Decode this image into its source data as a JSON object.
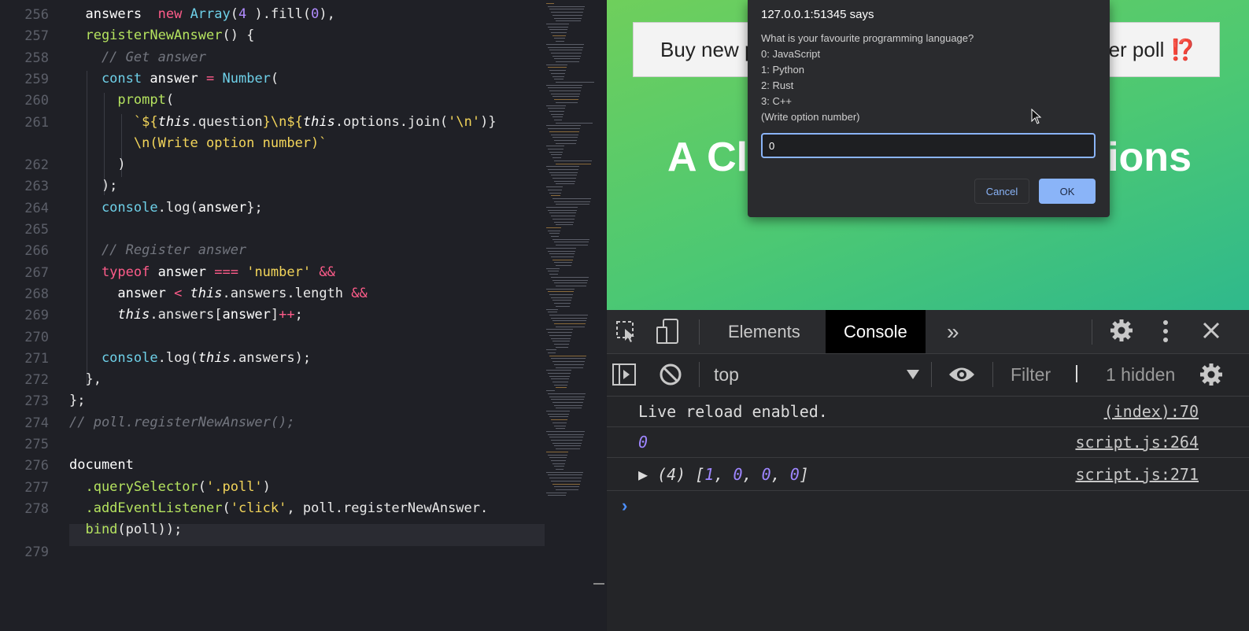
{
  "editor": {
    "line_numbers": [
      "256",
      "257",
      "258",
      "259",
      "260",
      "261",
      "",
      "262",
      "263",
      "264",
      "265",
      "266",
      "267",
      "268",
      "269",
      "270",
      "271",
      "272",
      "273",
      "274",
      "275",
      "276",
      "277",
      "278",
      "",
      "279"
    ],
    "lines": [
      {
        "segments": [
          [
            "pr",
            "  answers"
          ],
          [
            "",
            "  "
          ],
          [
            "kw",
            "new "
          ],
          [
            "cls",
            "Array"
          ],
          [
            "",
            "("
          ],
          [
            "nm",
            "4"
          ],
          [
            "",
            " ).fill("
          ],
          [
            "nm",
            "0"
          ],
          [
            "",
            "),"
          ]
        ]
      },
      {
        "segments": [
          [
            "fn",
            "  registerNewAnswer"
          ],
          [
            "",
            "() {"
          ]
        ]
      },
      {
        "segments": [
          [
            "cm",
            "    // Get answer"
          ]
        ]
      },
      {
        "segments": [
          [
            "cls",
            "    const "
          ],
          [
            "pr",
            "answer "
          ],
          [
            "kw",
            "= "
          ],
          [
            "cls",
            "Number"
          ],
          [
            "",
            "("
          ]
        ]
      },
      {
        "segments": [
          [
            "fn",
            "      prompt"
          ],
          [
            "",
            "("
          ]
        ]
      },
      {
        "segments": [
          [
            "st",
            "        `${"
          ],
          [
            "it",
            "this"
          ],
          [
            "",
            ".question"
          ],
          [
            "st",
            "}\\n${"
          ],
          [
            "it",
            "this"
          ],
          [
            "",
            ".options"
          ],
          [
            "",
            ".join("
          ],
          [
            "st",
            "'\\n'"
          ],
          [
            "",
            ")}"
          ]
        ]
      },
      {
        "segments": [
          [
            "st",
            "        \\n(Write option number)`"
          ]
        ]
      },
      {
        "segments": [
          [
            "",
            "      )"
          ]
        ]
      },
      {
        "segments": [
          [
            "",
            "    );"
          ]
        ]
      },
      {
        "segments": [
          [
            "cls",
            "    console"
          ],
          [
            "",
            ".log("
          ],
          [
            "pr",
            "answer"
          ],
          [
            "",
            "};"
          ]
        ]
      },
      {
        "segments": [
          [
            "",
            ""
          ]
        ]
      },
      {
        "segments": [
          [
            "cm",
            "    // Register answer"
          ]
        ]
      },
      {
        "segments": [
          [
            "kw",
            "    typeof "
          ],
          [
            "pr",
            "answer "
          ],
          [
            "kw",
            "=== "
          ],
          [
            "st",
            "'number' "
          ],
          [
            "kw",
            "&&"
          ]
        ]
      },
      {
        "segments": [
          [
            "pr",
            "      answer "
          ],
          [
            "kw",
            "< "
          ],
          [
            "it",
            "this"
          ],
          [
            "",
            ".answers.length "
          ],
          [
            "kw",
            "&&"
          ]
        ]
      },
      {
        "segments": [
          [
            "it",
            "      this"
          ],
          [
            "",
            ".answers["
          ],
          [
            "pr",
            "answer"
          ],
          [
            "",
            "]"
          ],
          [
            "kw",
            "++"
          ],
          [
            "",
            ";"
          ]
        ]
      },
      {
        "segments": [
          [
            "",
            ""
          ]
        ]
      },
      {
        "segments": [
          [
            "cls",
            "    console"
          ],
          [
            "",
            ".log("
          ],
          [
            "it",
            "this"
          ],
          [
            "",
            ".answers);"
          ]
        ]
      },
      {
        "segments": [
          [
            "",
            "  },"
          ]
        ]
      },
      {
        "segments": [
          [
            "",
            "};"
          ]
        ]
      },
      {
        "segments": [
          [
            "cm",
            "// poll.registerNewAnswer();"
          ]
        ]
      },
      {
        "segments": [
          [
            "",
            ""
          ]
        ]
      },
      {
        "segments": [
          [
            "pr",
            "document"
          ]
        ]
      },
      {
        "segments": [
          [
            "fn",
            "  .querySelector"
          ],
          [
            "",
            "("
          ],
          [
            "st",
            "'.poll'"
          ],
          [
            "",
            ")"
          ]
        ]
      },
      {
        "segments": [
          [
            "fn",
            "  .addEventListener"
          ],
          [
            "",
            "("
          ],
          [
            "st",
            "'click'"
          ],
          [
            "",
            ", poll.registerNewAnswer."
          ]
        ]
      },
      {
        "segments": [
          [
            "fn",
            "  bind"
          ],
          [
            "",
            "(poll));"
          ]
        ]
      },
      {
        "segments": [
          [
            "",
            ""
          ]
        ]
      }
    ]
  },
  "browser": {
    "poll_button": {
      "left_text": "Buy new p",
      "right_text": "ver poll",
      "emoji": "⁉️"
    },
    "heading": {
      "left_text": "A Cl",
      "right_text": "ions"
    }
  },
  "dialog": {
    "title": "127.0.0.1:51345 says",
    "lines": [
      "What is your favourite programming language?",
      "0: JavaScript",
      "1: Python",
      "2: Rust",
      "3: C++",
      "(Write option number)"
    ],
    "input_value": "0",
    "cancel_label": "Cancel",
    "ok_label": "OK"
  },
  "devtools": {
    "tabs": {
      "elements": "Elements",
      "console": "Console",
      "more": "»"
    },
    "toolbar": {
      "context": "top",
      "filter_placeholder": "Filter",
      "hidden_count": "1 hidden"
    },
    "messages": [
      {
        "text": "Live reload enabled.",
        "source": "(index):70"
      },
      {
        "text": "0",
        "source": "script.js:264"
      },
      {
        "prefix": "▶ (4) [",
        "values": [
          "1",
          "0",
          "0",
          "0"
        ],
        "suffix": "]",
        "source": "script.js:271"
      }
    ],
    "prompt_symbol": "›"
  },
  "colors": {
    "accent": "#8ab4f8",
    "console_number": "#9e86ff",
    "keyword": "#ff5c8a",
    "function": "#b5e35f",
    "string": "#f3d55a"
  }
}
